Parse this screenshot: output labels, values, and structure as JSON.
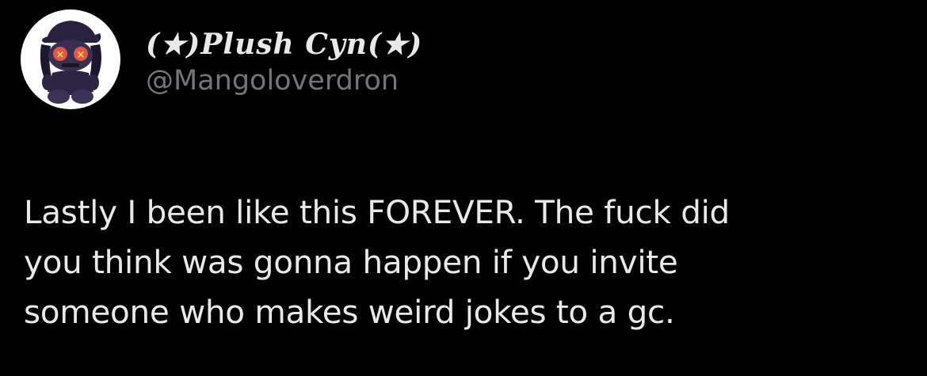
{
  "user": {
    "display_name": "(★)Plush Cyn(★)",
    "handle": "@Mangoloverdron",
    "avatar_icon": "plush-doll-avatar-icon"
  },
  "tweet": {
    "text": "Lastly I been like this FOREVER. The fuck did\nyou think was gonna happen if you invite\nsomeone who makes weird jokes to a gc."
  },
  "colors": {
    "background": "#000000",
    "primary_text": "#e7e9ea",
    "secondary_text": "#71767b",
    "avatar_background": "#ffffff"
  }
}
